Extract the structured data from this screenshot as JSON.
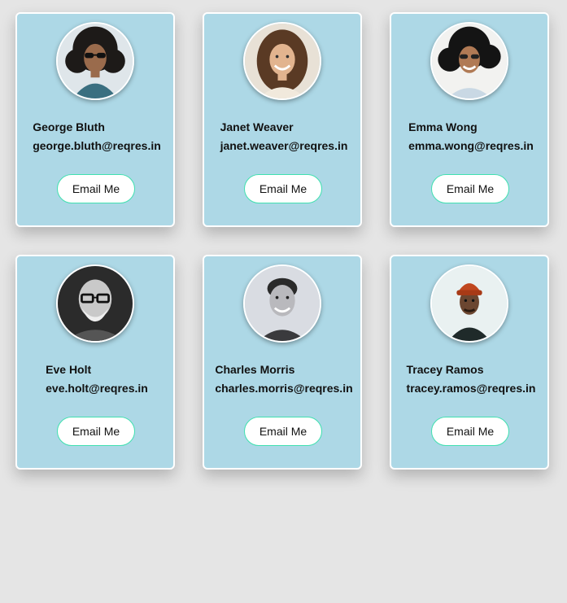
{
  "users": [
    {
      "name": "George Bluth",
      "email": "george.bluth@reqres.in",
      "button_label": "Email Me",
      "avatar": "photo-george-bluth"
    },
    {
      "name": "Janet Weaver",
      "email": "janet.weaver@reqres.in",
      "button_label": "Email Me",
      "avatar": "photo-janet-weaver"
    },
    {
      "name": "Emma Wong",
      "email": "emma.wong@reqres.in",
      "button_label": "Email Me",
      "avatar": "photo-emma-wong"
    },
    {
      "name": "Eve Holt",
      "email": "eve.holt@reqres.in",
      "button_label": "Email Me",
      "avatar": "photo-eve-holt"
    },
    {
      "name": "Charles Morris",
      "email": "charles.morris@reqres.in",
      "button_label": "Email Me",
      "avatar": "photo-charles-morris"
    },
    {
      "name": "Tracey Ramos",
      "email": "tracey.ramos@reqres.in",
      "button_label": "Email Me",
      "avatar": "photo-tracey-ramos"
    }
  ],
  "colors": {
    "page_background": "#e5e5e5",
    "card_background": "#add8e6",
    "card_border": "#ffffff",
    "button_border": "#40e0b0"
  }
}
